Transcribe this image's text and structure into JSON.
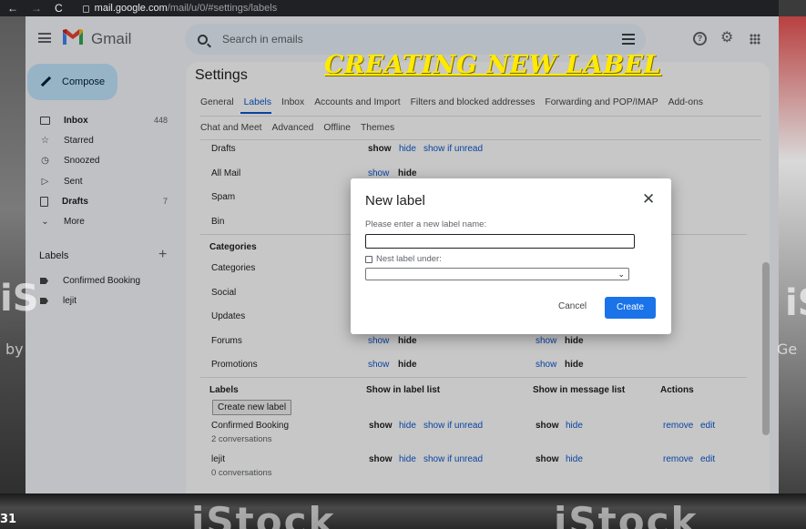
{
  "browser": {
    "url_host": "mail.google.com",
    "url_path": "/mail/u/0/#settings/labels",
    "back": "←",
    "forward": "→",
    "reload": "C"
  },
  "app": {
    "name": "Gmail",
    "search_placeholder": "Search in emails",
    "compose_label": "Compose"
  },
  "sidebar": {
    "items": [
      {
        "label": "Inbox",
        "count": "448",
        "icon": "inbox-icon",
        "bold": true
      },
      {
        "label": "Starred",
        "count": "",
        "icon": "star-icon",
        "bold": false
      },
      {
        "label": "Snoozed",
        "count": "",
        "icon": "clock-icon",
        "bold": false
      },
      {
        "label": "Sent",
        "count": "",
        "icon": "send-icon",
        "bold": false
      },
      {
        "label": "Drafts",
        "count": "7",
        "icon": "draft-icon",
        "bold": true
      },
      {
        "label": "More",
        "count": "",
        "icon": "chevron-down-icon",
        "bold": false
      }
    ],
    "labels_heading": "Labels",
    "labels": [
      "Confirmed Booking",
      "lejit"
    ]
  },
  "settings": {
    "title": "Settings",
    "tabs_row1": [
      "General",
      "Labels",
      "Inbox",
      "Accounts and Import",
      "Filters and blocked addresses",
      "Forwarding and POP/IMAP",
      "Add-ons"
    ],
    "tabs_row2": [
      "Chat and Meet",
      "Advanced",
      "Offline",
      "Themes"
    ],
    "active_tab": "Labels",
    "system_labels": [
      {
        "name": "Drafts",
        "show": "show",
        "hide": "hide",
        "unread": "show if unread"
      },
      {
        "name": "All Mail",
        "show": "show",
        "hide": "hide",
        "unread": ""
      },
      {
        "name": "Spam",
        "show": "",
        "hide": "",
        "unread": ""
      },
      {
        "name": "Bin",
        "show": "",
        "hide": "",
        "unread": ""
      }
    ],
    "categories_heading": "Categories",
    "categories": [
      {
        "name": "Categories",
        "show": "",
        "hide": "",
        "msg_show": "",
        "msg_hide": ""
      },
      {
        "name": "Social",
        "show": "",
        "hide": "",
        "msg_show": "",
        "msg_hide": ""
      },
      {
        "name": "Updates",
        "show": "",
        "hide": "",
        "msg_show": "",
        "msg_hide": ""
      },
      {
        "name": "Forums",
        "show": "show",
        "hide": "hide",
        "msg_show": "show",
        "msg_hide": "hide"
      },
      {
        "name": "Promotions",
        "show": "show",
        "hide": "hide",
        "msg_show": "show",
        "msg_hide": "hide"
      }
    ],
    "labels_table": {
      "col_labels": "Labels",
      "col_label_list": "Show in label list",
      "col_message_list": "Show in message list",
      "col_actions": "Actions",
      "create_button": "Create new label",
      "rows": [
        {
          "name": "Confirmed Booking",
          "conversations": "2 conversations",
          "show": "show",
          "hide": "hide",
          "unread": "show if unread",
          "msg_show": "show",
          "msg_hide": "hide",
          "remove": "remove",
          "edit": "edit"
        },
        {
          "name": "lejit",
          "conversations": "0 conversations",
          "show": "show",
          "hide": "hide",
          "unread": "show if unread",
          "msg_show": "show",
          "msg_hide": "hide",
          "remove": "remove",
          "edit": "edit"
        }
      ]
    }
  },
  "dialog": {
    "title": "New label",
    "close": "✕",
    "prompt": "Please enter a new label name:",
    "input_value": "",
    "nest_label": "Nest label under:",
    "nest_checked": false,
    "cancel": "Cancel",
    "create": "Create"
  },
  "overlay_text": {
    "banner": "CREATING NEW LABEL",
    "watermark": "iStock",
    "watermark_left_partial": "iS",
    "watermark_left_by": "by",
    "watermark_right_partial": "iS",
    "watermark_right_ge": "Ge",
    "corner_number": "31"
  },
  "colors": {
    "accent": "#0b57d0",
    "compose_bg": "#c2e7ff",
    "create_button": "#1a73e8",
    "banner": "#ffea00"
  }
}
